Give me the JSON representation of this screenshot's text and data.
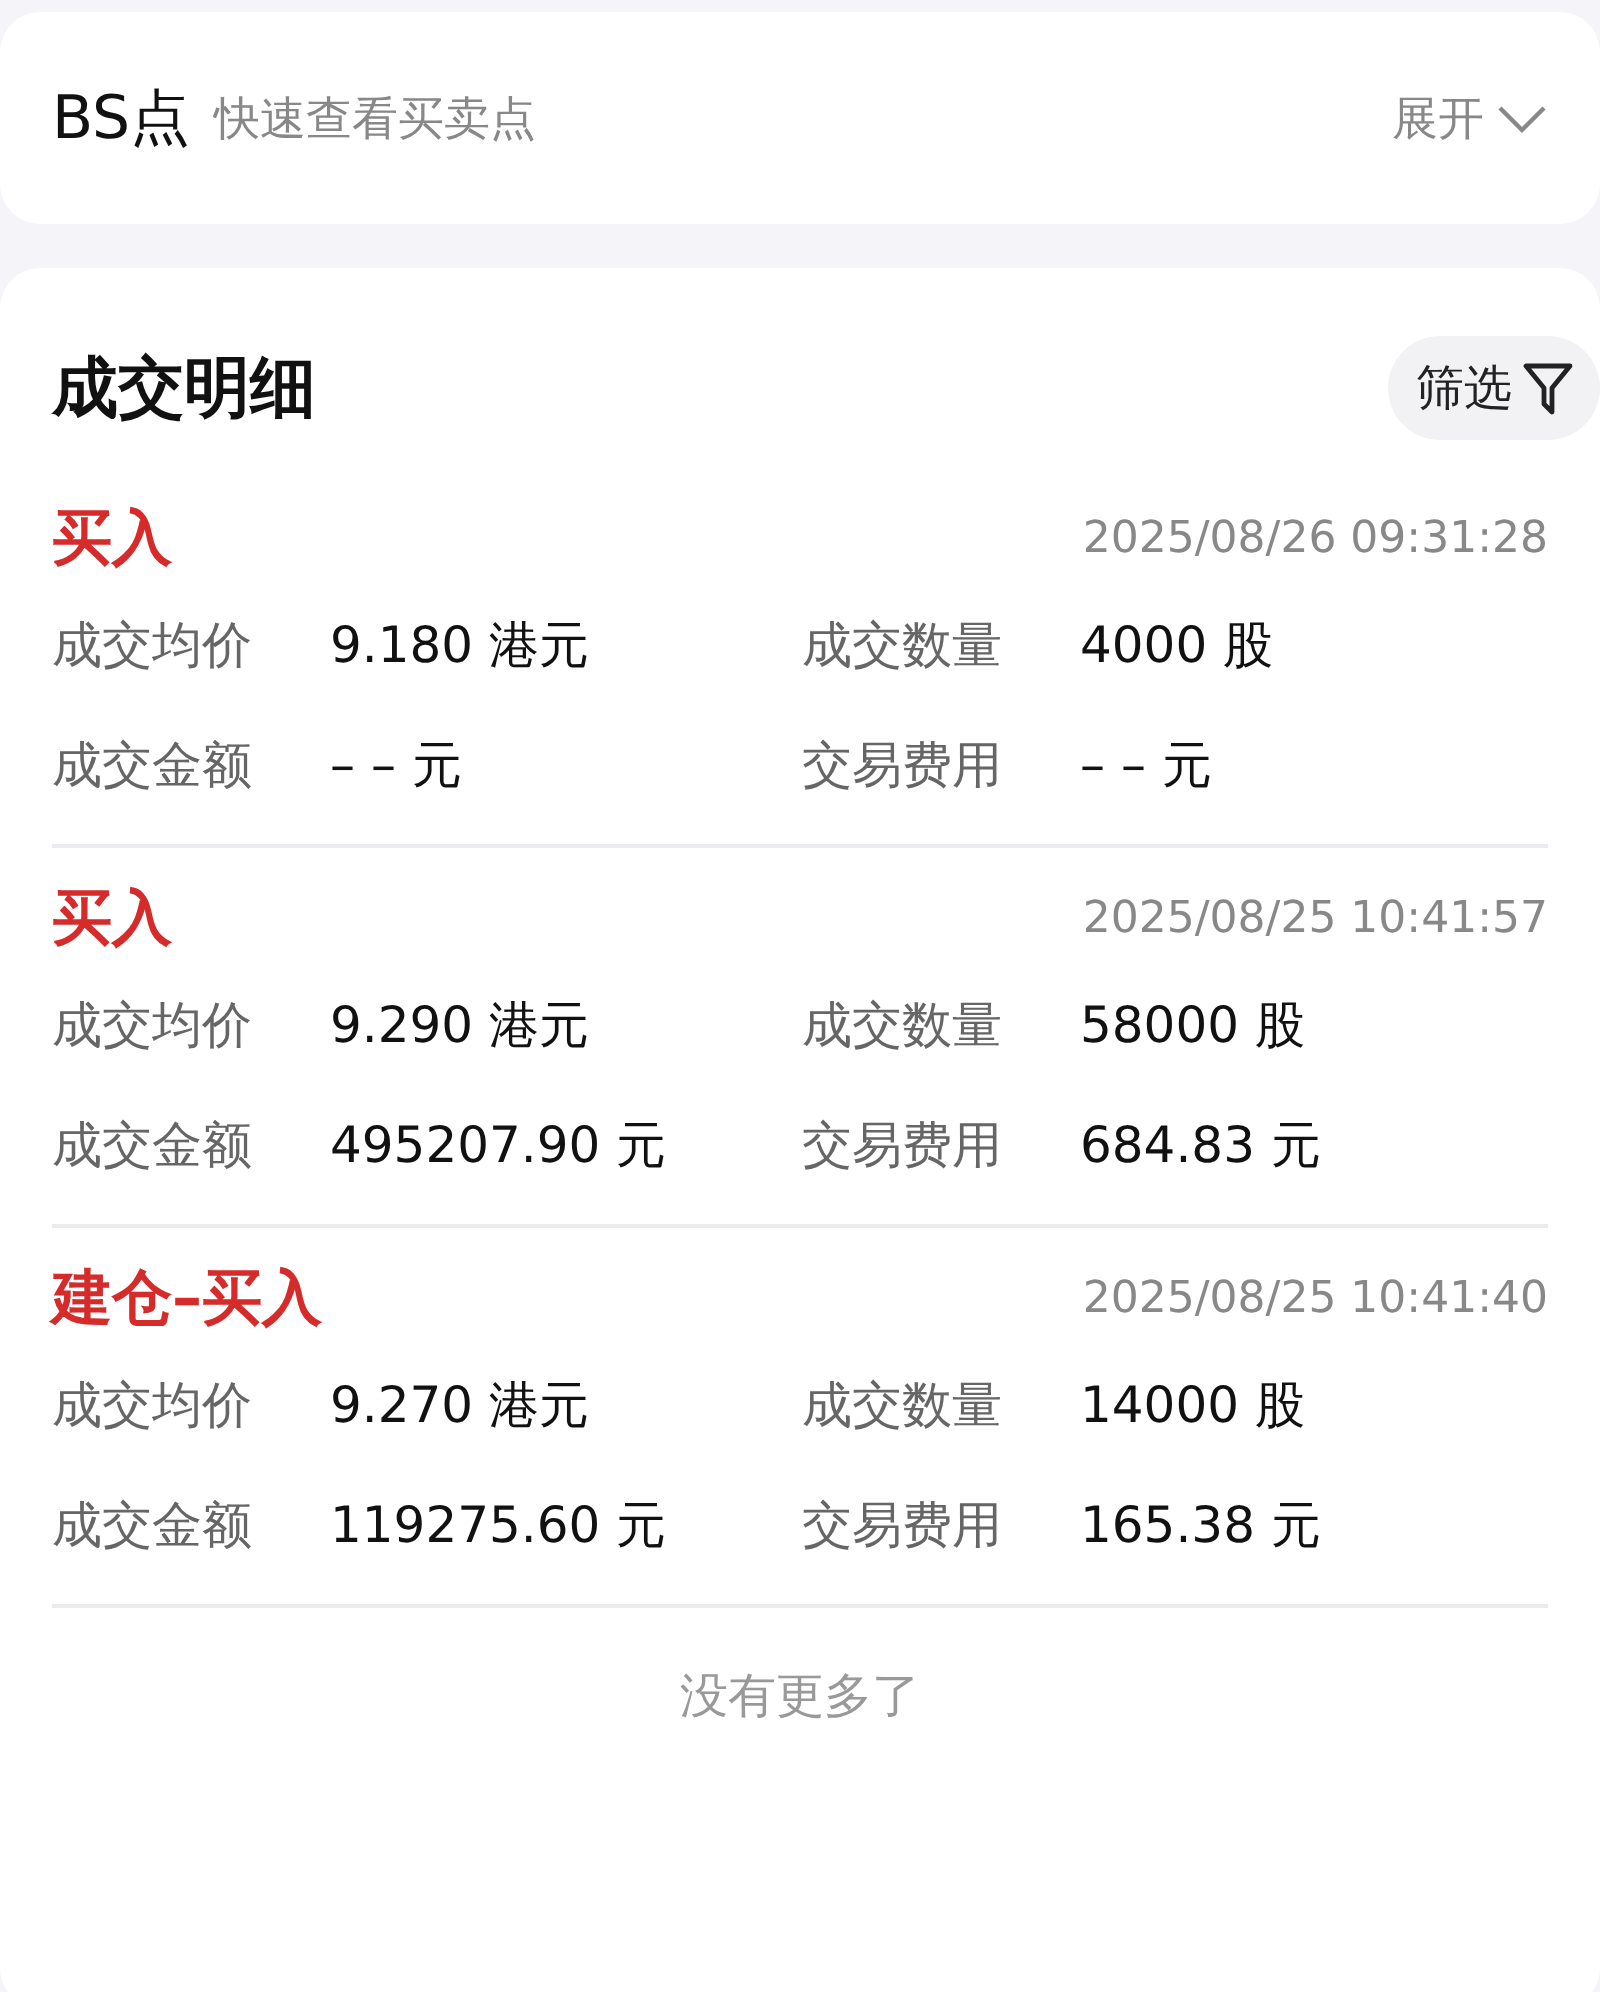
{
  "bs_card": {
    "title": "BS点",
    "subtitle": "快速查看买卖点",
    "toggle": "展开",
    "expanded": false
  },
  "trades_card": {
    "title": "成交明细",
    "filter_button": "筛选",
    "trades": [
      {
        "type": "买入",
        "time": "2025/08/26 09:31:28",
        "fields": [
          {
            "label": "成交均价",
            "value": "9.180 港元"
          },
          {
            "label": "成交数量",
            "value": "4000 股"
          },
          {
            "label": "成交金额",
            "value": "– – 元"
          },
          {
            "label": "交易费用",
            "value": "– – 元"
          }
        ]
      },
      {
        "type": "买入",
        "time": "2025/08/25 10:41:57",
        "fields": [
          {
            "label": "成交均价",
            "value": "9.290 港元"
          },
          {
            "label": "成交数量",
            "value": "58000 股"
          },
          {
            "label": "成交金额",
            "value": "495207.90 元"
          },
          {
            "label": "交易费用",
            "value": "684.83 元"
          }
        ]
      },
      {
        "type": "建仓–买入",
        "time": "2025/08/25 10:41:40",
        "fields": [
          {
            "label": "成交均价",
            "value": "9.270 港元"
          },
          {
            "label": "成交数量",
            "value": "14000 股"
          },
          {
            "label": "成交金额",
            "value": "119275.60 元"
          },
          {
            "label": "交易费用",
            "value": "165.38 元"
          }
        ]
      }
    ],
    "footer": "没有更多了"
  }
}
